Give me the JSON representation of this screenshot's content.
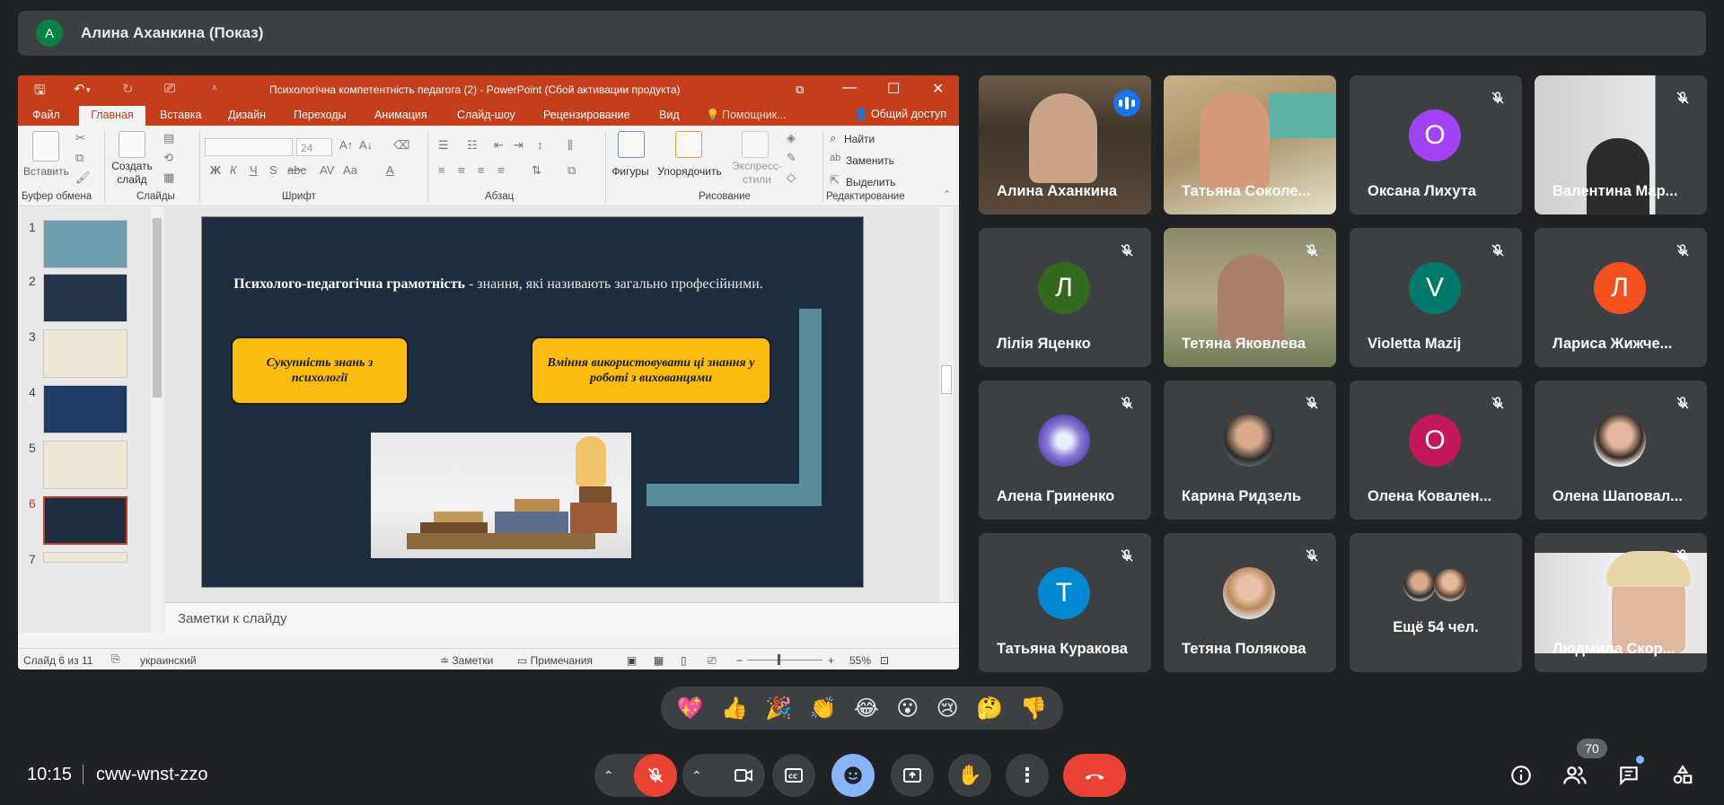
{
  "presenter_bar": {
    "avatar_letter": "A",
    "title": "Алина Аханкина (Показ)"
  },
  "powerpoint": {
    "title": "Психологічна компетентність педагога (2) - PowerPoint (Сбой активации продукта)",
    "tabs": [
      "Файл",
      "Главная",
      "Вставка",
      "Дизайн",
      "Переходы",
      "Анимация",
      "Слайд-шоу",
      "Рецензирование",
      "Вид",
      "Помощник..."
    ],
    "share": "Общий доступ",
    "ribbon": {
      "paste": "Вставить",
      "create_slide": "Создать слайд",
      "font_size": "24",
      "shapes": "Фигуры",
      "arrange": "Упорядочить",
      "express_styles": "Экспресс-стили",
      "find": "Найти",
      "replace": "Заменить",
      "select": "Выделить",
      "groups": [
        "Буфер обмена",
        "Слайды",
        "Шрифт",
        "Абзац",
        "Рисование",
        "Редактирование"
      ]
    },
    "thumb_numbers": [
      "1",
      "2",
      "3",
      "4",
      "5",
      "6",
      "7"
    ],
    "slide": {
      "heading_bold": "Психолого-педагогічна грамотність",
      "heading_rest": " - знання, які називають загально професійними.",
      "box_left": "Сукупність знань з психології",
      "box_right": "Вміння використовувати ці знання у роботі з вихованцями"
    },
    "notes_placeholder": "Заметки к слайду",
    "status": {
      "slide_info": "Слайд 6 из 11",
      "language": "украинский",
      "notes": "Заметки",
      "comments": "Примечания",
      "zoom": "55%"
    }
  },
  "participants": [
    {
      "name": "Алина Аханкина",
      "type": "video",
      "speaking": true
    },
    {
      "name": "Татьяна Соколе...",
      "type": "video"
    },
    {
      "name": "Оксана Лихута",
      "type": "avatar",
      "letter": "О",
      "color": "#a142f4"
    },
    {
      "name": "Валентина Мар...",
      "type": "video"
    },
    {
      "name": "Лілія Яценко",
      "type": "avatar",
      "letter": "Л",
      "color": "#33691e"
    },
    {
      "name": "Тетяна Яковлева",
      "type": "video"
    },
    {
      "name": "Violetta Mazij",
      "type": "avatar",
      "letter": "V",
      "color": "#00796b"
    },
    {
      "name": "Лариса Жижче...",
      "type": "avatar",
      "letter": "Л",
      "color": "#f4511e"
    },
    {
      "name": "Алена Гриненко",
      "type": "photo"
    },
    {
      "name": "Карина Ридзель",
      "type": "photo"
    },
    {
      "name": "Олена Ковален...",
      "type": "avatar",
      "letter": "О",
      "color": "#c2185b"
    },
    {
      "name": "Олена Шаповал...",
      "type": "photo"
    },
    {
      "name": "Татьяна Куракова",
      "type": "avatar",
      "letter": "Т",
      "color": "#0288d1"
    },
    {
      "name": "Тетяна Полякова",
      "type": "photo"
    },
    {
      "name": "Ещё 54 чел.",
      "type": "more"
    },
    {
      "name": "Людмила Скор...",
      "type": "video"
    }
  ],
  "reactions": [
    "💖",
    "👍",
    "🎉",
    "👏",
    "😂",
    "😮",
    "😢",
    "🤔",
    "👎"
  ],
  "bottom_bar": {
    "time": "10:15",
    "meeting_code": "cww-wnst-zzo",
    "participants_count": "70",
    "colors": {
      "end_call": "#ea4335",
      "mic_off": "#ea4335",
      "emoji_active": "#8ab4f8"
    }
  }
}
